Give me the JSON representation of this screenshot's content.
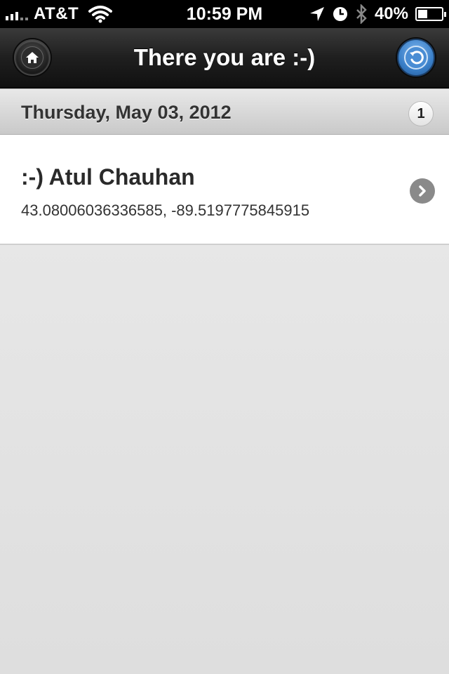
{
  "status_bar": {
    "carrier": "AT&T",
    "time": "10:59 PM",
    "battery": "40%",
    "battery_level": 0.4,
    "icons": [
      "signal-icon",
      "wifi-icon",
      "location-arrow-icon",
      "alarm-clock-icon",
      "bluetooth-icon",
      "battery-icon"
    ]
  },
  "header": {
    "title": "There you are :-)",
    "left_icon": "home-icon",
    "right_icon": "back-arrow-icon"
  },
  "divider": {
    "date": "Thursday, May 03, 2012",
    "count": "1"
  },
  "list": {
    "items": [
      {
        "title": ":-) Atul Chauhan",
        "subtitle": "43.08006036336585, -89.5197775845915",
        "icon": "chevron-right-icon"
      }
    ]
  },
  "colors": {
    "header_bg": "#1f1f1f",
    "back_button": "#3a7fc8",
    "page_bg": "#e4e4e4"
  }
}
